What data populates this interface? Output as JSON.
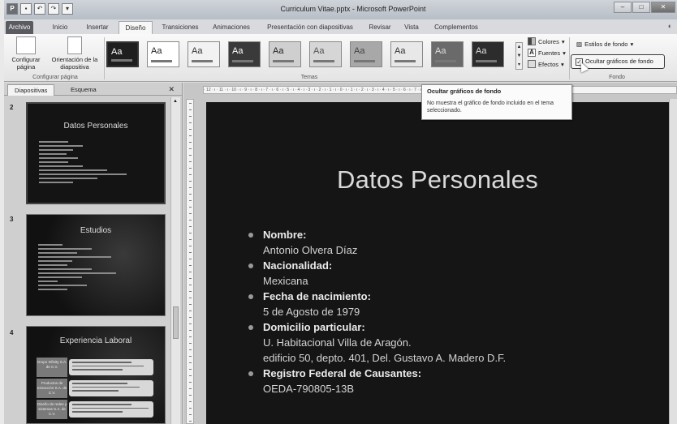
{
  "window": {
    "title": "Curriculum Vitae.pptx - Microsoft PowerPoint",
    "app_icon": "P",
    "qat": [
      "save-icon",
      "undo-icon",
      "redo-icon",
      "customize-icon"
    ],
    "buttons": [
      "–",
      "□",
      "✕"
    ]
  },
  "tabs": [
    {
      "label": "Archivo"
    },
    {
      "label": "Inicio"
    },
    {
      "label": "Insertar"
    },
    {
      "label": "Diseño"
    },
    {
      "label": "Transiciones"
    },
    {
      "label": "Animaciones"
    },
    {
      "label": "Presentación con diapositivas"
    },
    {
      "label": "Revisar"
    },
    {
      "label": "Vista"
    },
    {
      "label": "Complementos"
    }
  ],
  "ribbon": {
    "config": {
      "page_label": "Configurar página",
      "orient_label": "Orientación de la diapositiva",
      "group_label": "Configurar página"
    },
    "themes_group_label": "Temas",
    "themes": [
      {
        "text": "Aa",
        "bg": "#1f1f1f",
        "fg": "#ffffff"
      },
      {
        "text": "Aa",
        "bg": "#ffffff",
        "fg": "#222222"
      },
      {
        "text": "Aa",
        "bg": "#f2f2f2",
        "fg": "#333333"
      },
      {
        "text": "Aa",
        "bg": "#3a3a3a",
        "fg": "#ffffff"
      },
      {
        "text": "Aa",
        "bg": "#cfcfcf",
        "fg": "#222222"
      },
      {
        "text": "Aa",
        "bg": "#d6d6d6",
        "fg": "#555555"
      },
      {
        "text": "Aa",
        "bg": "#a8a8a8",
        "fg": "#444444"
      },
      {
        "text": "Aa",
        "bg": "#e8e8e8",
        "fg": "#333333"
      },
      {
        "text": "Aa",
        "bg": "#6a6a6a",
        "fg": "#dddddd"
      },
      {
        "text": "Aa",
        "bg": "#2c2c2c",
        "fg": "#dddddd"
      }
    ],
    "colors_label": "Colores",
    "fonts_label": "Fuentes",
    "effects_label": "Efectos",
    "bg_styles_label": "Estilos de fondo",
    "hide_bg_label": "Ocultar gráficos de fondo",
    "fondo_group_label": "Fondo"
  },
  "tooltip": {
    "title": "Ocultar gráficos de fondo",
    "body": "No muestra el gráfico de fondo incluido en el tema seleccionado."
  },
  "panel": {
    "tabs": [
      "Diapositivas",
      "Esquema"
    ],
    "close": "✕",
    "slides": [
      {
        "num": "2",
        "title": "Datos Personales"
      },
      {
        "num": "3",
        "title": "Estudios"
      },
      {
        "num": "4",
        "title": "Experiencia Laboral"
      }
    ],
    "slide4_items": [
      "Grupo Infinity S.A. de C.V.",
      "Productos de extracción S.A. de C.V.",
      "Diseño de redes y sistemas S.A. de C.V."
    ]
  },
  "ruler_text": "· 12 · ı · 11 · ı · 10 · ı · 9 · ı · 8 · ı · 7 · ı · 6 · ı · 5 · ı · 4 · ı · 3 · ı · 2 · ı · 1 · ı · 0 · ı · 1 · ı · 2 · ı · 3 · ı · 4 · ı · 5 · ı · 6 · ı · 7 · ı · 8 · ı · 9 · ı · 10 · ı · 11 · ı · 12 ·",
  "slide": {
    "title": "Datos Personales",
    "items": [
      {
        "label": "Nombre:",
        "values": [
          "Antonio  Olvera Díaz"
        ]
      },
      {
        "label": "Nacionalidad:",
        "values": [
          "Mexicana"
        ]
      },
      {
        "label": "Fecha de nacimiento:",
        "values": [
          "5 de Agosto de 1979"
        ]
      },
      {
        "label": "Domicilio  particular:",
        "values": [
          "U. Habitacional  Villa de Aragón.",
          "edificio 50, depto. 401, Del. Gustavo A. Madero D.F."
        ]
      },
      {
        "label": "Registro Federal de Causantes:",
        "values": [
          "OEDA-790805-13B"
        ]
      }
    ]
  }
}
